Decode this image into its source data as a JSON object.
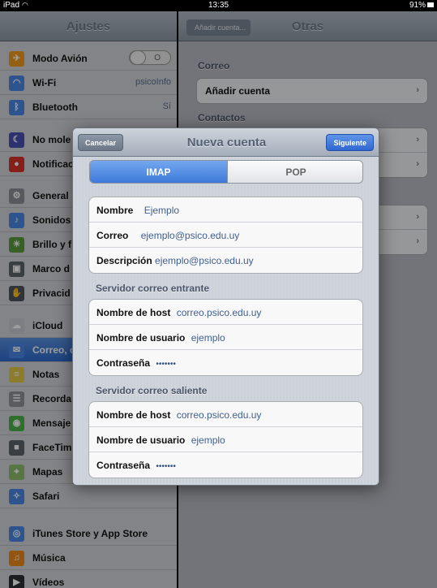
{
  "status": {
    "device": "iPad",
    "time": "13:35",
    "battery": "91%"
  },
  "left": {
    "title": "Ajustes",
    "rows": [
      {
        "label": "Modo Avión",
        "toggle": "O",
        "icon": "airplane-icon",
        "color": "#f29b1d"
      },
      {
        "label": "Wi-Fi",
        "value": "psicoInfo",
        "icon": "wifi-icon",
        "color": "#4a88e6"
      },
      {
        "label": "Bluetooth",
        "value": "Sí",
        "icon": "bluetooth-icon",
        "color": "#4a88e6"
      },
      {
        "label": "No mole",
        "icon": "moon-icon",
        "color": "#4a4fb3"
      },
      {
        "label": "Notificac",
        "icon": "notifications-icon",
        "color": "#d9312b"
      },
      {
        "label": "General",
        "icon": "gear-icon",
        "color": "#8b9199"
      },
      {
        "label": "Sonidos",
        "icon": "speaker-icon",
        "color": "#4a88e6"
      },
      {
        "label": "Brillo y f",
        "icon": "brightness-icon",
        "color": "#5a9b3a"
      },
      {
        "label": "Marco d",
        "icon": "picture-frame-icon",
        "color": "#5d646c"
      },
      {
        "label": "Privacid",
        "icon": "hand-icon",
        "color": "#4d5560"
      },
      {
        "label": "iCloud",
        "icon": "cloud-icon",
        "color": "#c7ccd3"
      },
      {
        "label": "Correo, c",
        "icon": "mail-icon",
        "color": "#4a88e6"
      },
      {
        "label": "Notas",
        "icon": "notes-icon",
        "color": "#e6c84a"
      },
      {
        "label": "Recorda",
        "icon": "reminders-icon",
        "color": "#8e9399"
      },
      {
        "label": "Mensaje",
        "icon": "messages-icon",
        "color": "#4db34a"
      },
      {
        "label": "FaceTim",
        "icon": "facetime-icon",
        "color": "#5d646c"
      },
      {
        "label": "Mapas",
        "icon": "maps-icon",
        "color": "#8fbf6b"
      },
      {
        "label": "Safari",
        "icon": "safari-icon",
        "color": "#4a88e6"
      },
      {
        "label": "iTunes Store y App Store",
        "icon": "appstore-icon",
        "color": "#4a88e6"
      },
      {
        "label": "Música",
        "icon": "music-icon",
        "color": "#ef8a1a"
      },
      {
        "label": "Vídeos",
        "icon": "videos-icon",
        "color": "#2c3036"
      }
    ]
  },
  "right": {
    "back": "Añadir cuenta...",
    "title": "Otras",
    "correo_header": "Correo",
    "add_account": "Añadir cuenta",
    "contactos_header": "Contactos"
  },
  "modal": {
    "cancel": "Cancelar",
    "title": "Nueva cuenta",
    "next": "Siguiente",
    "seg_imap": "IMAP",
    "seg_pop": "POP",
    "account": {
      "name_label": "Nombre",
      "name_value": "Ejemplo",
      "email_label": "Correo",
      "email_value": "ejemplo@psico.edu.uy",
      "desc_label": "Descripción",
      "desc_value": "ejemplo@psico.edu.uy"
    },
    "incoming_header": "Servidor correo entrante",
    "incoming": {
      "host_label": "Nombre de host",
      "host_value": "correo.psico.edu.uy",
      "user_label": "Nombre de usuario",
      "user_value": "ejemplo",
      "pass_label": "Contraseña",
      "pass_value": "•••••••"
    },
    "outgoing_header": "Servidor correo saliente",
    "outgoing": {
      "host_label": "Nombre de host",
      "host_value": "correo.psico.edu.uy",
      "user_label": "Nombre de usuario",
      "user_value": "ejemplo",
      "pass_label": "Contraseña",
      "pass_value": "•••••••"
    }
  }
}
